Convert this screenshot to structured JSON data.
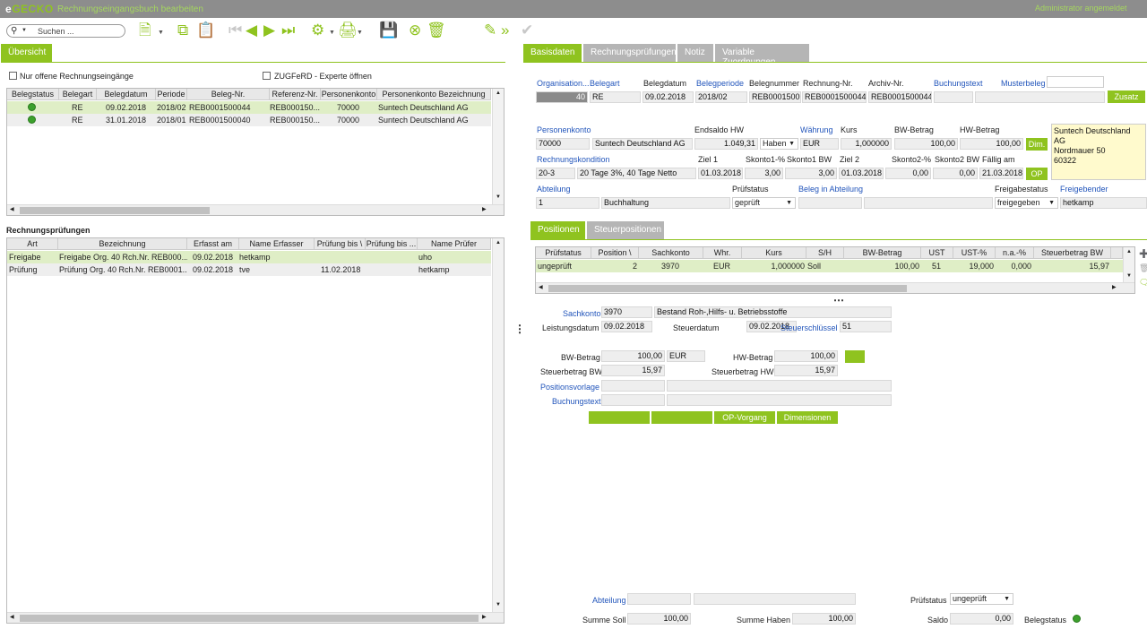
{
  "app": {
    "logo_prefix": "e",
    "logo_main": "GECKO",
    "title": "Rechnungseingangsbuch bearbeiten",
    "user_info": "Administrator angemeldet"
  },
  "toolbar": {
    "search_placeholder": "Suchen ..."
  },
  "left": {
    "tab_overview": "Übersicht",
    "filter_open": "Nur offene Rechnungseingänge",
    "filter_zugferd": "ZUGFeRD - Experte öffnen",
    "invoices": {
      "columns": [
        "Belegstatus",
        "Belegart",
        "Belegdatum",
        "Periode",
        "Beleg-Nr.",
        "Referenz-Nr.",
        "Personenkonto",
        "Personenkonto Bezeichnung"
      ],
      "rows": [
        {
          "belegart": "RE",
          "datum": "09.02.2018",
          "periode": "2018/02",
          "beleg": "REB0001500044",
          "referenz": "REB000150...",
          "konto": "70000",
          "bezeichnung": "Suntech Deutschland AG"
        },
        {
          "belegart": "RE",
          "datum": "31.01.2018",
          "periode": "2018/01",
          "beleg": "REB0001500040",
          "referenz": "REB000150...",
          "konto": "70000",
          "bezeichnung": "Suntech Deutschland AG"
        }
      ]
    },
    "checks_title": "Rechnungsprüfungen",
    "checks": {
      "columns": [
        "Art",
        "Bezeichnung",
        "Erfasst am",
        "Name Erfasser",
        "Prüfung bis \\",
        "Prüfung bis ...",
        "Name Prüfer"
      ],
      "rows": [
        {
          "art": "Freigabe",
          "bez": "Freigabe Org. 40 Rch.Nr. REB000...",
          "erfasst": "09.02.2018",
          "erfasser": "hetkamp",
          "bis1": "",
          "bis2": "",
          "pruefer": "uho"
        },
        {
          "art": "Prüfung",
          "bez": "Prüfung Org. 40 Rch.Nr. REB0001...",
          "erfasst": "09.02.2018",
          "erfasser": "tve",
          "bis1": "11.02.2018",
          "bis2": "",
          "pruefer": "hetkamp"
        }
      ]
    }
  },
  "right": {
    "tabs": [
      "Basisdaten",
      "Rechnungsprüfungen",
      "Notiz",
      "Variable Zuordnungen"
    ],
    "head": {
      "labels": {
        "org": "Organisation...",
        "belegart": "Belegart",
        "belegdatum": "Belegdatum",
        "belegperiode": "Belegperiode",
        "belegnummer": "Belegnummer",
        "rechnung": "Rechnung-Nr.",
        "archiv": "Archiv-Nr.",
        "buchungstext": "Buchungstext",
        "musterbeleg": "Musterbeleg"
      },
      "values": {
        "org": "40",
        "belegart": "RE",
        "belegdatum": "09.02.2018",
        "belegperiode": "2018/02",
        "belegnummer": "REB0001500",
        "rechnung": "REB0001500044",
        "archiv": "REB0001500044",
        "buchungstext": "",
        "musterbeleg": ""
      },
      "zusatz": "Zusatz"
    },
    "konto": {
      "labels": {
        "personenkonto": "Personenkonto",
        "endsaldo": "Endsaldo HW",
        "waehrung": "Währung",
        "kurs": "Kurs",
        "bw": "BW-Betrag",
        "hw": "HW-Betrag"
      },
      "values": {
        "konto": "70000",
        "name": "Suntech Deutschland AG",
        "endsaldo": "1.049,31",
        "sh": "Haben",
        "waehrung": "EUR",
        "kurs": "1,000000",
        "bw": "100,00",
        "hw": "100,00"
      },
      "dim": "Dim.",
      "address": [
        "Suntech Deutschland AG",
        "Nordmauer 50",
        "60322"
      ]
    },
    "kondition": {
      "labels": {
        "rk": "Rechnungskondition",
        "ziel1": "Ziel 1",
        "sk1p": "Skonto1-%",
        "sk1bw": "Skonto1 BW",
        "ziel2": "Ziel 2",
        "sk2p": "Skonto2-%",
        "sk2bw": "Skonto2 BW",
        "faellig": "Fällig am"
      },
      "values": {
        "rk": "20-3",
        "rktext": "20 Tage 3%, 40 Tage Netto",
        "ziel1": "01.03.2018",
        "sk1p": "3,00",
        "sk1bw": "3,00",
        "ziel2": "01.03.2018",
        "sk2p": "0,00",
        "sk2bw": "0,00",
        "faellig": "21.03.2018"
      },
      "op": "OP"
    },
    "abteilung": {
      "labels": {
        "abteilung": "Abteilung",
        "pruefstatus": "Prüfstatus",
        "beleg_abt": "Beleg in Abteilung",
        "freigabestatus": "Freigabestatus",
        "freigebender": "Freigebender"
      },
      "values": {
        "abt": "1",
        "abtname": "Buchhaltung",
        "pruefstatus": "geprüft",
        "beleg_abt": "",
        "beleg_abt2": "",
        "freigabestatus": "freigegeben",
        "freigebender": "hetkamp"
      }
    },
    "subtabs": [
      "Positionen",
      "Steuerpositionen"
    ],
    "positions": {
      "columns": [
        "Prüfstatus",
        "Position \\",
        "Sachkonto",
        "Whr.",
        "Kurs",
        "S/H",
        "BW-Betrag",
        "UST",
        "UST-%",
        "n.a.-%",
        "Steuerbetrag BW"
      ],
      "rows": [
        {
          "status": "ungeprüft",
          "pos": "2",
          "sachkonto": "3970",
          "whr": "EUR",
          "kurs": "1,000000",
          "sh": "Soll",
          "bw": "100,00",
          "ust": "51",
          "ustp": "19,000",
          "na": "0,000",
          "steuer": "15,97"
        }
      ]
    },
    "detail": {
      "labels": {
        "sachkonto": "Sachkonto",
        "leistungsdatum": "Leistungsdatum",
        "steuerdatum": "Steuerdatum",
        "steuerschluessel": "Steuerschlüssel",
        "bw": "BW-Betrag",
        "hw": "HW-Betrag",
        "stbw": "Steuerbetrag BW",
        "sthw": "Steuerbetrag HW",
        "positionsvorlage": "Positionsvorlage",
        "buchungstext": "Buchungstext"
      },
      "values": {
        "sachkonto": "3970",
        "sachkonto_name": "Bestand Roh-,Hilfs- u. Betriebsstoffe",
        "leistungsdatum": "09.02.2018",
        "steuerdatum": "09.02.2018",
        "steuerschluessel": "51",
        "bw": "100,00",
        "waehrung": "EUR",
        "hw": "100,00",
        "stbw": "15,97",
        "sthw": "15,97",
        "positionsvorlage": "",
        "buchungstext": ""
      },
      "btn_op": "OP-Vorgang",
      "btn_dim": "Dimensionen"
    },
    "footer": {
      "labels": {
        "abteilung": "Abteilung",
        "pruefstatus": "Prüfstatus",
        "summe_soll": "Summe Soll",
        "summe_haben": "Summe Haben",
        "saldo": "Saldo",
        "belegstatus": "Belegstatus"
      },
      "values": {
        "abteilung": "",
        "abteilung2": "",
        "pruefstatus": "ungeprüft",
        "summe_soll": "100,00",
        "summe_haben": "100,00",
        "saldo": "0,00"
      }
    }
  },
  "colors": {
    "accent": "#8fc31f",
    "link": "#2255bb",
    "selected_row": "#dfeec6",
    "status_ok": "#3ca02c"
  }
}
